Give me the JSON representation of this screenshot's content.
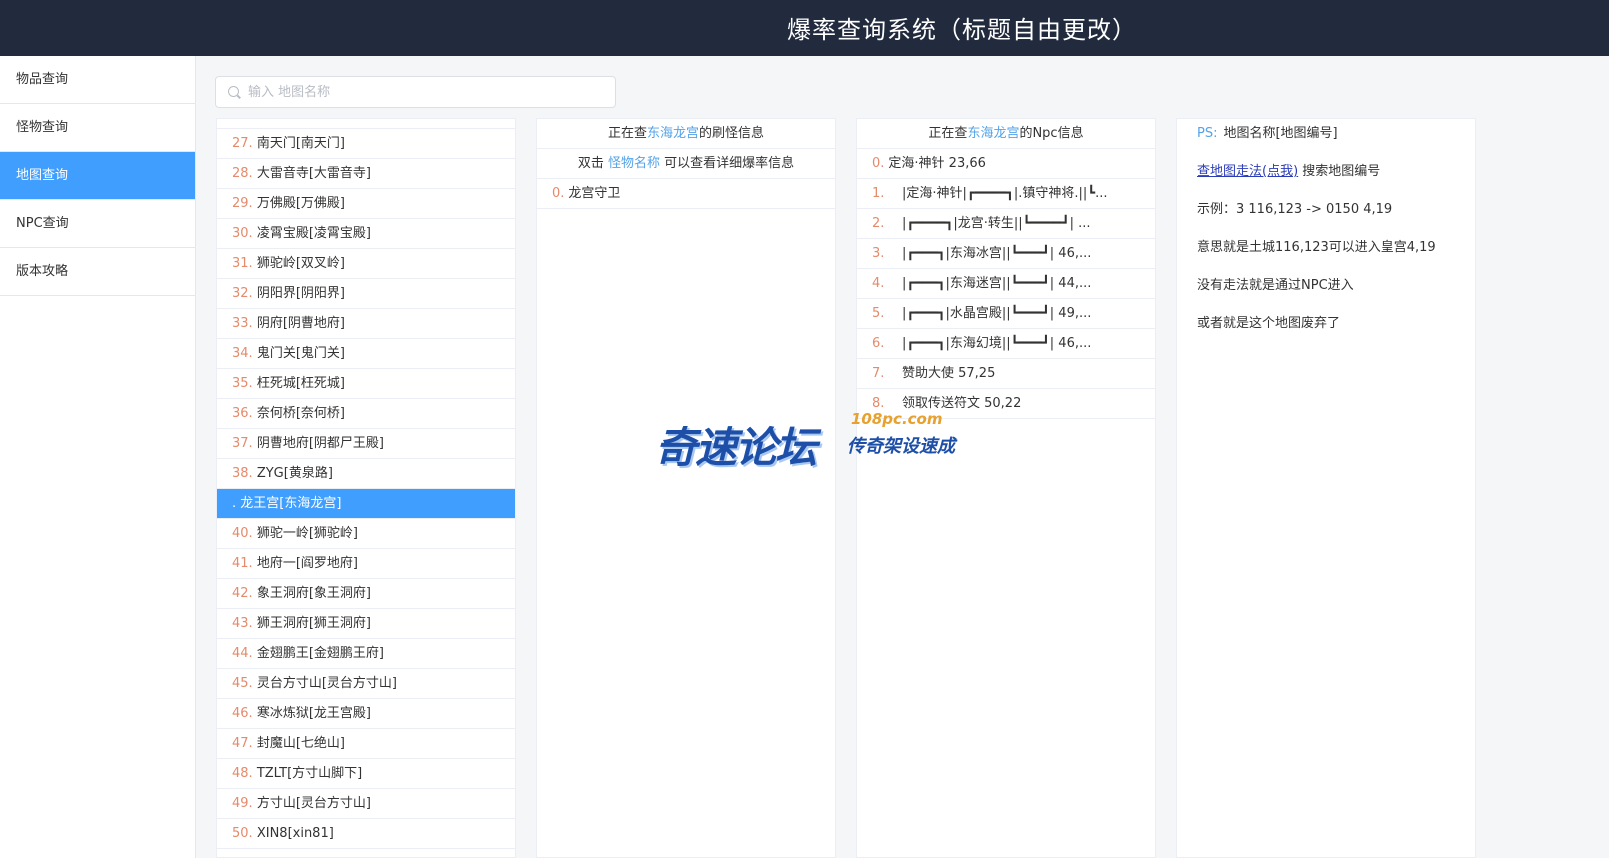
{
  "header": {
    "title": "爆率查询系统（标题自由更改）"
  },
  "sidebar": {
    "items": [
      {
        "label": "物品查询"
      },
      {
        "label": "怪物查询"
      },
      {
        "label": "地图查询"
      },
      {
        "label": "NPC查询"
      },
      {
        "label": "版本攻略"
      }
    ],
    "active_index": 2
  },
  "search": {
    "placeholder": "输入 地图名称",
    "value": ""
  },
  "map_list": {
    "items": [
      {
        "num": "27.",
        "name": "南天门[南天门]"
      },
      {
        "num": "28.",
        "name": "大雷音寺[大雷音寺]"
      },
      {
        "num": "29.",
        "name": "万佛殿[万佛殿]"
      },
      {
        "num": "30.",
        "name": "凌霄宝殿[凌霄宝殿]"
      },
      {
        "num": "31.",
        "name": "狮驼岭[双叉岭]"
      },
      {
        "num": "32.",
        "name": "阴阳界[阴阳界]"
      },
      {
        "num": "33.",
        "name": "阴府[阴曹地府]"
      },
      {
        "num": "34.",
        "name": "鬼门关[鬼门关]"
      },
      {
        "num": "35.",
        "name": "枉死城[枉死城]"
      },
      {
        "num": "36.",
        "name": "奈何桥[奈何桥]"
      },
      {
        "num": "37.",
        "name": "阴曹地府[阴都尸王殿]"
      },
      {
        "num": "38.",
        "name": "ZYG[黄泉路]"
      },
      {
        "num": "",
        "name": ". 龙王宫[东海龙宫]"
      },
      {
        "num": "40.",
        "name": "狮驼一岭[狮驼岭]"
      },
      {
        "num": "41.",
        "name": "地府一[阎罗地府]"
      },
      {
        "num": "42.",
        "name": "象王洞府[象王洞府]"
      },
      {
        "num": "43.",
        "name": "狮王洞府[狮王洞府]"
      },
      {
        "num": "44.",
        "name": "金翅鹏王[金翅鹏王府]"
      },
      {
        "num": "45.",
        "name": "灵台方寸山[灵台方寸山]"
      },
      {
        "num": "46.",
        "name": "寒冰炼狱[龙王宫殿]"
      },
      {
        "num": "47.",
        "name": "封魔山[七绝山]"
      },
      {
        "num": "48.",
        "name": "TZLT[方寸山脚下]"
      },
      {
        "num": "49.",
        "name": "方寸山[灵台方寸山]"
      },
      {
        "num": "50.",
        "name": "XIN8[xin81]"
      }
    ]
  },
  "monster_panel": {
    "prefix": "正在查",
    "map": "东海龙宫",
    "suffix": "的刷怪信息",
    "hint_prefix": "双击",
    "hint_link": "怪物名称",
    "hint_suffix": "可以查看详细爆率信息",
    "rows": [
      {
        "num": "0.",
        "text": "龙宫守卫"
      }
    ]
  },
  "npc_panel": {
    "prefix": "正在查",
    "map": "东海龙宫",
    "suffix": "的Npc信息",
    "rows": [
      {
        "num": "0.",
        "text": "定海·神针 23,66"
      },
      {
        "num": "1.",
        "text": "|定海·神针|┏━━━━┓|.镇守神将.||┗..."
      },
      {
        "num": "2.",
        "text": "|┏━━━━┓|龙宫·转生||┗━━━━┛|   ..."
      },
      {
        "num": "3.",
        "text": "|┏━━━┓|东海冰宫||┗━━━┛|   46,..."
      },
      {
        "num": "4.",
        "text": "|┏━━━┓|东海迷宫||┗━━━┛|   44,..."
      },
      {
        "num": "5.",
        "text": "|┏━━━┓|水晶宫殿||┗━━━┛|   49,..."
      },
      {
        "num": "6.",
        "text": "|┏━━━┓|东海幻境||┗━━━┛|   46,..."
      },
      {
        "num": "7.",
        "text": "赞助大使     57,25"
      },
      {
        "num": "8.",
        "text": "领取传送符文 50,22"
      }
    ]
  },
  "info_panel": {
    "ps_label": "PS:",
    "ps_text": "地图名称[地图编号]",
    "link_text": "查地图走法(点我)",
    "link_after": "搜索地图编号",
    "example": "示例：3 116,123 -> 0150 4,19",
    "meaning": "意思就是土城116,123可以进入皇宫4,19",
    "npc_note": "没有走法就是通过NPC进入",
    "abandoned": "或者就是这个地图废弃了"
  },
  "watermark": {
    "main": "奇速论坛",
    "url": "108pc.com",
    "sub": "传奇架设速成"
  },
  "colors": {
    "header_bg": "#222b3e",
    "active_blue": "#409eff",
    "number_orange": "#e58a6b",
    "link_blue": "#55a3e8"
  }
}
